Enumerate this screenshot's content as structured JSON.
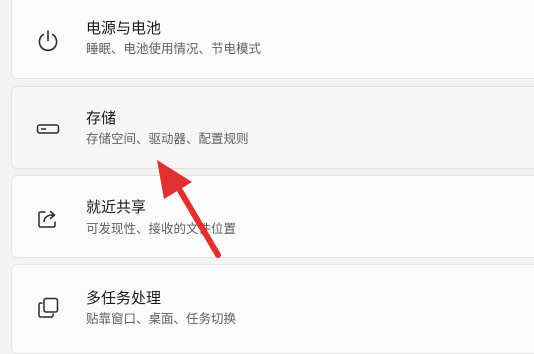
{
  "settings_list": {
    "items": [
      {
        "title": "电源与电池",
        "subtitle": "睡眠、电池使用情况、节电模式",
        "icon": "power-icon"
      },
      {
        "title": "存储",
        "subtitle": "存储空间、驱动器、配置规则",
        "icon": "storage-drive-icon"
      },
      {
        "title": "就近共享",
        "subtitle": "可发现性、接收的文件位置",
        "icon": "share-icon"
      },
      {
        "title": "多任务处理",
        "subtitle": "贴靠窗口、桌面、任务切换",
        "icon": "multitasking-icon"
      }
    ]
  },
  "annotation": {
    "icon": "red-arrow-icon",
    "color": "#e03030"
  },
  "colors": {
    "background": "#f3f3f3",
    "card": "#fbfbfb",
    "title_text": "#1a1a1a",
    "subtitle_text": "#606060"
  }
}
